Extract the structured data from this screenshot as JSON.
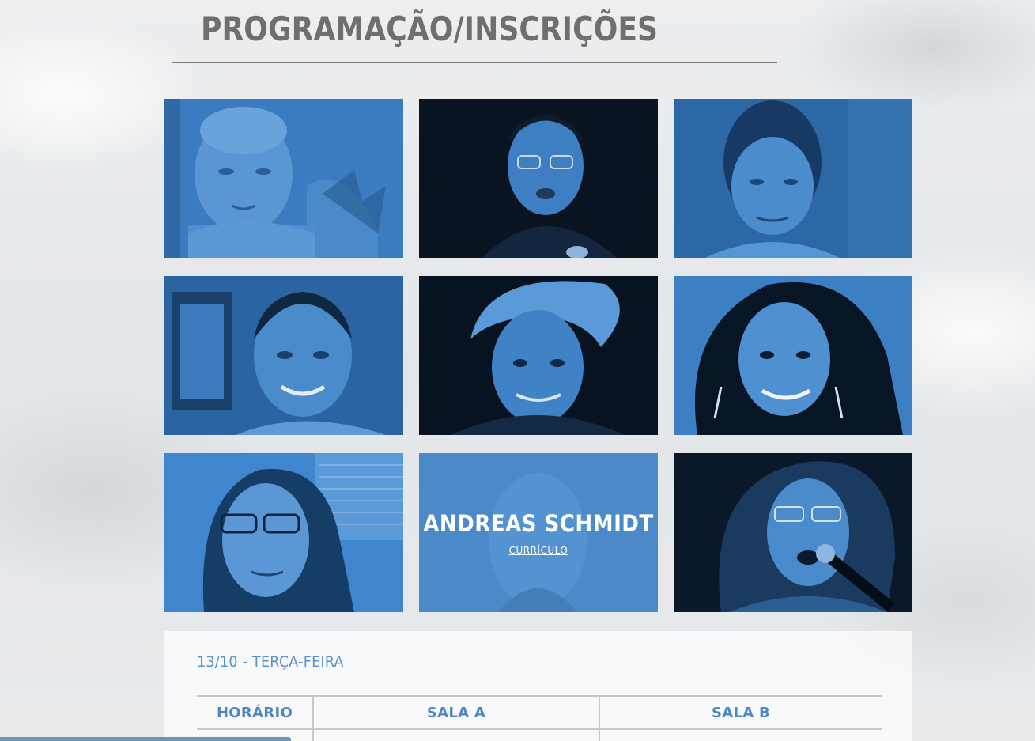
{
  "page": {
    "title": "PROGRAMAÇÃO/INSCRIÇÕES",
    "accent_color": "#5696d6"
  },
  "speakers": [
    {
      "id": "speaker-1",
      "tone": "#3a78bd"
    },
    {
      "id": "speaker-2",
      "tone": "#0b1420"
    },
    {
      "id": "speaker-3",
      "tone": "#2e6aa8"
    },
    {
      "id": "speaker-4",
      "tone": "#2c69a6"
    },
    {
      "id": "speaker-5",
      "tone": "#0a1a2c"
    },
    {
      "id": "speaker-6",
      "tone": "#0c1624"
    },
    {
      "id": "speaker-7",
      "tone": "#3f86cf"
    },
    {
      "id": "speaker-8",
      "tone": "#4a8ccc",
      "hover": true,
      "name": "ANDREAS SCHMIDT",
      "link_label": "CURRÍCULO"
    },
    {
      "id": "speaker-9",
      "tone": "#0b1b2e"
    }
  ],
  "schedule": {
    "day_label": "13/10 - TERÇA-FEIRA",
    "columns": [
      "HORÁRIO",
      "SALA A",
      "SALA B"
    ]
  }
}
